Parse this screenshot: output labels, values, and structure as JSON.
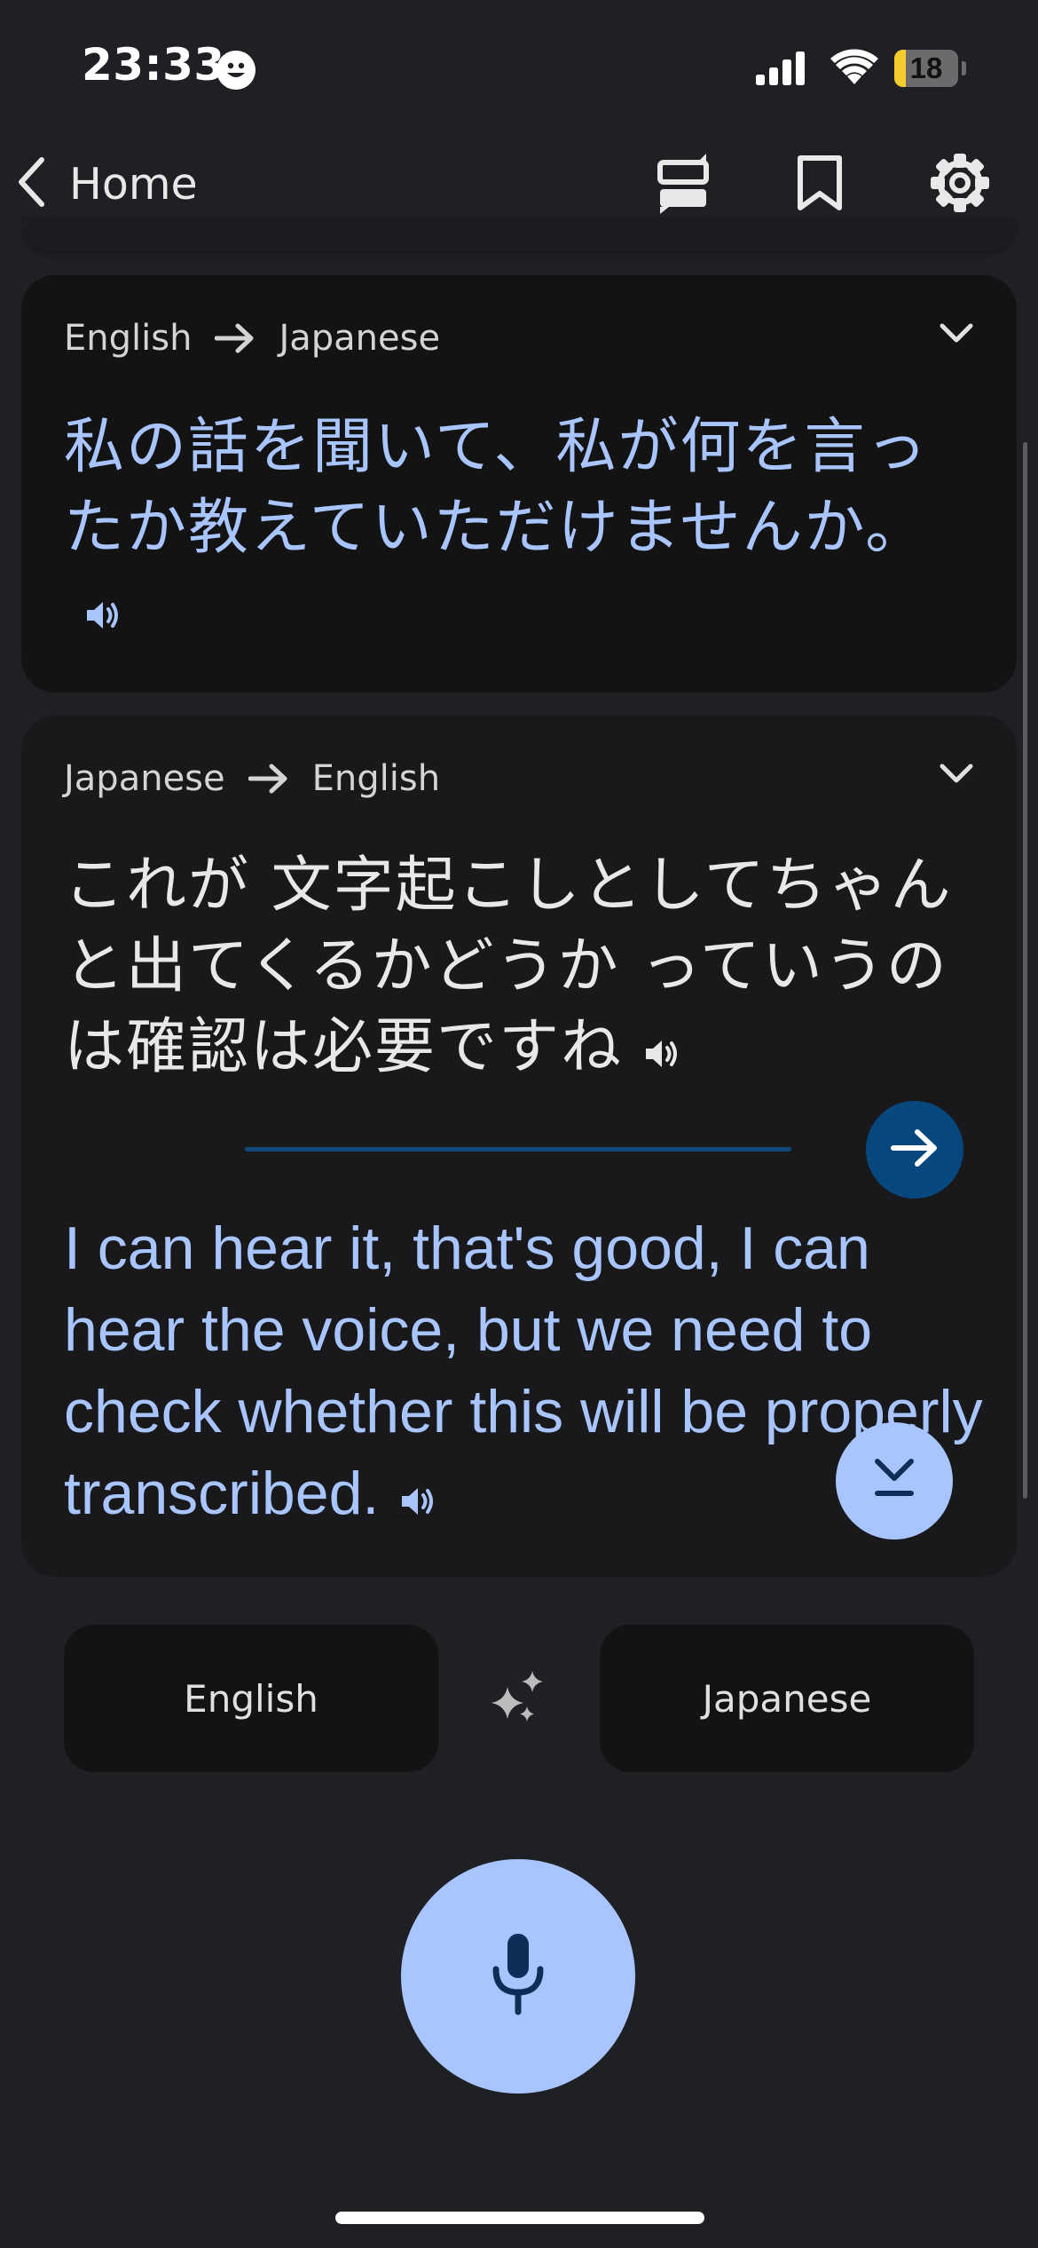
{
  "status_bar": {
    "time": "23:33",
    "battery_level": "18",
    "battery_fraction": 0.18
  },
  "header": {
    "back_label": "Home"
  },
  "conversation": [
    {
      "source_lang": "English",
      "target_lang": "Japanese",
      "translation_text": "私の話を聞いて、私が何を言ったか教えていただけませんか。"
    },
    {
      "source_lang": "Japanese",
      "target_lang": "English",
      "original_text": "これが 文字起こしとしてちゃんと出てくるかどうか っていうのは確認は必要ですね",
      "translation_text": "I can hear it, that's good, I can hear the voice, but we need to check whether this will be properly transcribed."
    }
  ],
  "language_selector": {
    "left": "English",
    "right": "Japanese"
  },
  "icons": {
    "back": "chevron-left-icon",
    "layout": "split-view-icon",
    "bookmark": "bookmark-icon",
    "settings": "gear-icon",
    "speaker": "speaker-icon",
    "send": "arrow-right-icon",
    "scroll": "scroll-to-bottom-icon",
    "sparkle": "sparkle-icon",
    "mic": "microphone-icon"
  },
  "colors": {
    "background": "#1f2023",
    "accent_blue": "#a8c5ff",
    "send_button": "#06477e"
  }
}
